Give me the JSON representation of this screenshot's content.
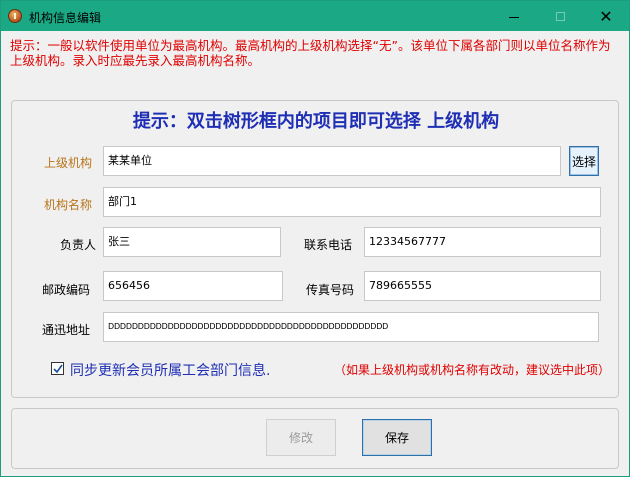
{
  "window": {
    "title": "机构信息编辑",
    "minimize_icon": "minimize-icon",
    "maximize_icon": "maximize-icon",
    "close_glyph": "✕"
  },
  "hint_top": "提示：一般以软件使用单位为最高机构。最高机构的上级机构选择“无”。该单位下属各部门则以单位名称作为上级机构。录入时应最先录入最高机构名称。",
  "heading": "提示：双击树形框内的项目即可选择  上级机构",
  "form": {
    "parent_org_label": "上级机构",
    "parent_org_value": "某某单位",
    "select_button": "选择",
    "org_name_label": "机构名称",
    "org_name_value": "部门1",
    "manager_label": "负责人",
    "manager_value": "张三",
    "phone_label": "联系电话",
    "phone_value": "12334567777",
    "postcode_label": "邮政编码",
    "postcode_value": "656456",
    "fax_label": "传真号码",
    "fax_value": "789665555",
    "address_label": "通迅地址",
    "address_value": "DDDDDDDDDDDDDDDDDDDDDDDDDDDDDDDDDDDDDDDDDDDDDDD"
  },
  "sync": {
    "checked": true,
    "label": "同步更新会员所属工会部门信息.",
    "note": "（如果上级机构或机构名称有改动，建议选中此项）"
  },
  "buttons": {
    "modify": "修改",
    "save": "保存"
  },
  "colors": {
    "titlebar": "#1aa885",
    "hint_red": "#e00000",
    "heading_blue": "#1f2fb5",
    "label_orange": "#b8741a"
  }
}
